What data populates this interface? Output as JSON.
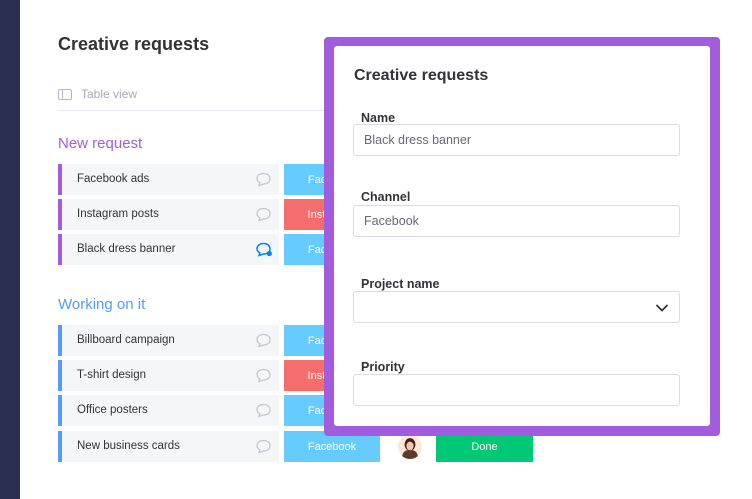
{
  "board": {
    "title": "Creative requests",
    "view_label": "Table view",
    "groups": [
      {
        "title": "New request",
        "color": "#a25ddc",
        "rows": [
          {
            "label": "Facebook ads",
            "channel": "Facebook",
            "channel_color": "#66ccff",
            "active_updates": false
          },
          {
            "label": "Instagram posts",
            "channel": "Instagram",
            "channel_color": "#f56d6d",
            "active_updates": false
          },
          {
            "label": "Black dress banner",
            "channel": "Facebook",
            "channel_color": "#66ccff",
            "active_updates": true
          }
        ]
      },
      {
        "title": "Working on it",
        "color": "#579bfc",
        "rows": [
          {
            "label": "Billboard campaign",
            "channel": "Facebook",
            "channel_color": "#66ccff",
            "active_updates": false
          },
          {
            "label": "T-shirt design",
            "channel": "Instagram",
            "channel_color": "#f56d6d",
            "active_updates": false
          },
          {
            "label": "Office posters",
            "channel": "Facebook",
            "channel_color": "#66ccff",
            "active_updates": false
          },
          {
            "label": "New business cards",
            "channel": "Facebook",
            "channel_color": "#66ccff",
            "active_updates": false,
            "owner": "avatar",
            "status": "Done",
            "status_color": "#00c875"
          }
        ]
      }
    ]
  },
  "form": {
    "title": "Creative requests",
    "accent_color": "#a25ddc",
    "fields": [
      {
        "label": "Name",
        "value": "Black dress banner",
        "type": "text"
      },
      {
        "label": "Channel",
        "value": "Facebook",
        "type": "text"
      },
      {
        "label": "Project name",
        "value": "",
        "type": "dropdown"
      },
      {
        "label": "Priority",
        "value": "",
        "type": "text"
      }
    ]
  },
  "icons": {
    "view": "table-view-icon",
    "updates": "speech-bubble-icon",
    "dropdown": "chevron-down-icon"
  }
}
